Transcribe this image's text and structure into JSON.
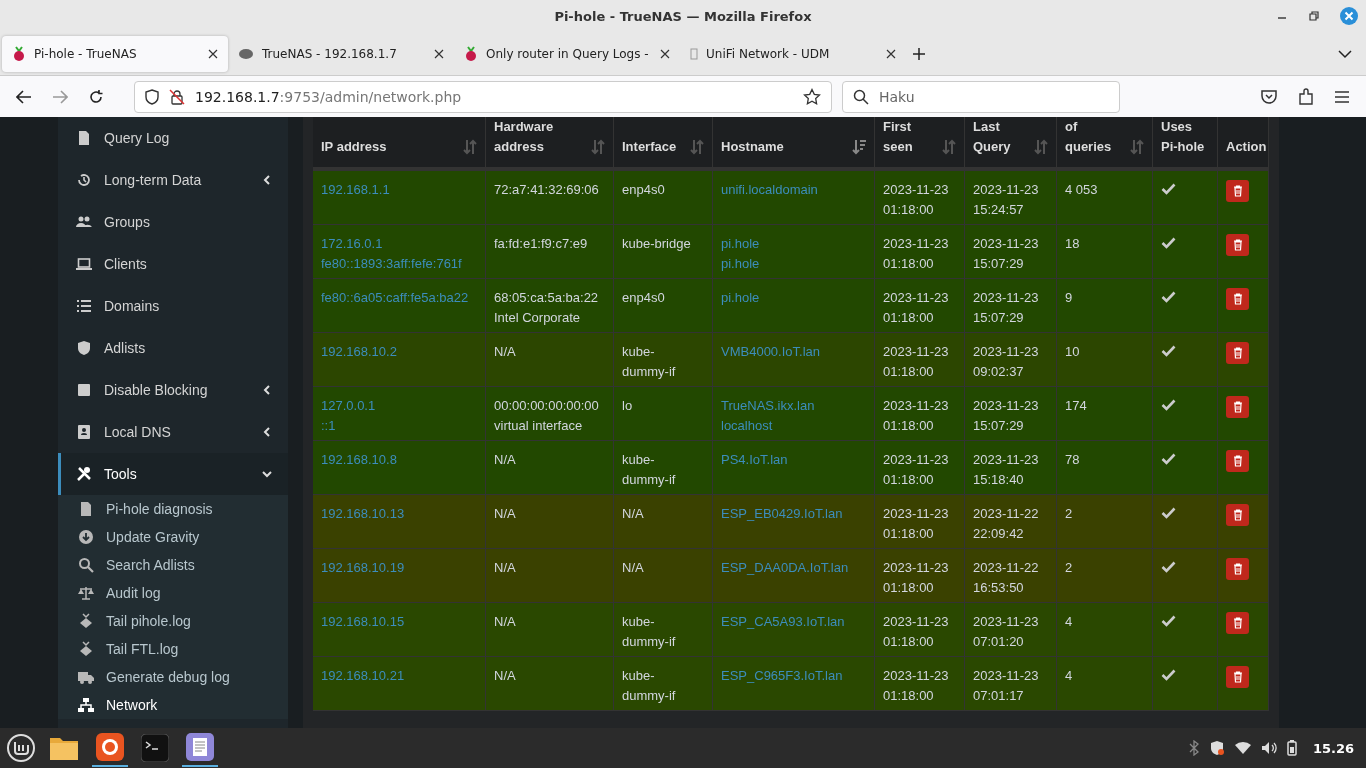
{
  "window": {
    "title": "Pi-hole - TrueNAS — Mozilla Firefox"
  },
  "tabs": [
    {
      "label": "Pi-hole - TrueNAS",
      "selected": true
    },
    {
      "label": "TrueNAS - 192.168.1.7",
      "selected": false
    },
    {
      "label": "Only router in Query Logs -",
      "selected": false
    },
    {
      "label": "UniFi Network - UDM",
      "selected": false
    }
  ],
  "address_bar": {
    "host": "192.168.1.7",
    "rest": ":9753/admin/network.php"
  },
  "search": {
    "placeholder": "Haku"
  },
  "sidebar": {
    "items": [
      {
        "label": "Query Log",
        "has_submenu": false,
        "expanded": false
      },
      {
        "label": "Long-term Data",
        "has_submenu": true,
        "expanded": false
      },
      {
        "label": "Groups",
        "has_submenu": false,
        "expanded": false
      },
      {
        "label": "Clients",
        "has_submenu": false,
        "expanded": false
      },
      {
        "label": "Domains",
        "has_submenu": false,
        "expanded": false
      },
      {
        "label": "Adlists",
        "has_submenu": false,
        "expanded": false
      },
      {
        "label": "Disable Blocking",
        "has_submenu": true,
        "expanded": false
      },
      {
        "label": "Local DNS",
        "has_submenu": true,
        "expanded": false
      },
      {
        "label": "Tools",
        "has_submenu": true,
        "expanded": true,
        "children": [
          {
            "label": "Pi-hole diagnosis",
            "selected": false
          },
          {
            "label": "Update Gravity",
            "selected": false
          },
          {
            "label": "Search Adlists",
            "selected": false
          },
          {
            "label": "Audit log",
            "selected": false
          },
          {
            "label": "Tail pihole.log",
            "selected": false
          },
          {
            "label": "Tail FTL.log",
            "selected": false
          },
          {
            "label": "Generate debug log",
            "selected": false
          },
          {
            "label": "Network",
            "selected": true
          }
        ]
      }
    ]
  },
  "table": {
    "columns": [
      {
        "lines": [
          "IP address"
        ],
        "sortable": true,
        "sorted": false
      },
      {
        "lines": [
          "Hardware",
          "address"
        ],
        "sortable": true,
        "sorted": false
      },
      {
        "lines": [
          "Interface"
        ],
        "sortable": true,
        "sorted": false
      },
      {
        "lines": [
          "Hostname"
        ],
        "sortable": true,
        "sorted": true
      },
      {
        "lines": [
          "First",
          "seen"
        ],
        "sortable": true,
        "sorted": false
      },
      {
        "lines": [
          "Last",
          "Query"
        ],
        "sortable": true,
        "sorted": false
      },
      {
        "lines": [
          "of",
          "queries"
        ],
        "sortable": true,
        "sorted": false
      },
      {
        "lines": [
          "Uses",
          "Pi-hole"
        ],
        "sortable": false
      },
      {
        "lines": [
          "Action"
        ],
        "sortable": false
      }
    ],
    "rows": [
      {
        "color": "#224800",
        "ips": [
          "192.168.1.1"
        ],
        "hardware": [
          "72:a7:41:32:69:06"
        ],
        "interface": [
          "enp4s0"
        ],
        "hostnames": [
          "unifi.localdomain"
        ],
        "first_seen": [
          "2023-11-23",
          "01:18:00"
        ],
        "last_query": [
          "2023-11-23",
          "15:24:57"
        ],
        "queries": "4 053",
        "uses_pihole": true
      },
      {
        "color": "#224800",
        "ips": [
          "172.16.0.1",
          "fe80::1893:3aff:fefe:761f"
        ],
        "hardware": [
          "fa:fd:e1:f9:c7:e9"
        ],
        "interface": [
          "kube-bridge"
        ],
        "hostnames": [
          "pi.hole",
          "pi.hole"
        ],
        "first_seen": [
          "2023-11-23",
          "01:18:00"
        ],
        "last_query": [
          "2023-11-23",
          "15:07:29"
        ],
        "queries": "18",
        "uses_pihole": true
      },
      {
        "color": "#224800",
        "ips": [
          "fe80::6a05:caff:fe5a:ba22"
        ],
        "hardware": [
          "68:05:ca:5a:ba:22",
          "Intel Corporate"
        ],
        "interface": [
          "enp4s0"
        ],
        "hostnames": [
          "pi.hole"
        ],
        "first_seen": [
          "2023-11-23",
          "01:18:00"
        ],
        "last_query": [
          "2023-11-23",
          "15:07:29"
        ],
        "queries": "9",
        "uses_pihole": true
      },
      {
        "color": "#2c4600",
        "ips": [
          "192.168.10.2"
        ],
        "hardware": [
          "N/A"
        ],
        "interface": [
          "kube-",
          "dummy-if"
        ],
        "hostnames": [
          "VMB4000.IoT.lan"
        ],
        "first_seen": [
          "2023-11-23",
          "01:18:00"
        ],
        "last_query": [
          "2023-11-23",
          "09:02:37"
        ],
        "queries": "10",
        "uses_pihole": true
      },
      {
        "color": "#224800",
        "ips": [
          "127.0.0.1",
          "::1"
        ],
        "hardware": [
          "00:00:00:00:00:00",
          "virtual interface"
        ],
        "interface": [
          "lo"
        ],
        "hostnames": [
          "TrueNAS.ikx.lan",
          "localhost"
        ],
        "first_seen": [
          "2023-11-23",
          "01:18:00"
        ],
        "last_query": [
          "2023-11-23",
          "15:07:29"
        ],
        "queries": "174",
        "uses_pihole": true
      },
      {
        "color": "#224800",
        "ips": [
          "192.168.10.8"
        ],
        "hardware": [
          "N/A"
        ],
        "interface": [
          "kube-",
          "dummy-if"
        ],
        "hostnames": [
          "PS4.IoT.lan"
        ],
        "first_seen": [
          "2023-11-23",
          "01:18:00"
        ],
        "last_query": [
          "2023-11-23",
          "15:18:40"
        ],
        "queries": "78",
        "uses_pihole": true
      },
      {
        "color": "#3a4100",
        "ips": [
          "192.168.10.13"
        ],
        "hardware": [
          "N/A"
        ],
        "interface": [
          "N/A"
        ],
        "hostnames": [
          "ESP_EB0429.IoT.lan"
        ],
        "first_seen": [
          "2023-11-23",
          "01:18:00"
        ],
        "last_query": [
          "2023-11-22",
          "22:09:42"
        ],
        "queries": "2",
        "uses_pihole": true
      },
      {
        "color": "#3a4100",
        "ips": [
          "192.168.10.19"
        ],
        "hardware": [
          "N/A"
        ],
        "interface": [
          "N/A"
        ],
        "hostnames": [
          "ESP_DAA0DA.IoT.lan"
        ],
        "first_seen": [
          "2023-11-23",
          "01:18:00"
        ],
        "last_query": [
          "2023-11-22",
          "16:53:50"
        ],
        "queries": "2",
        "uses_pihole": true
      },
      {
        "color": "#2a4800",
        "ips": [
          "192.168.10.15"
        ],
        "hardware": [
          "N/A"
        ],
        "interface": [
          "kube-",
          "dummy-if"
        ],
        "hostnames": [
          "ESP_CA5A93.IoT.lan"
        ],
        "first_seen": [
          "2023-11-23",
          "01:18:00"
        ],
        "last_query": [
          "2023-11-23",
          "07:01:20"
        ],
        "queries": "4",
        "uses_pihole": true
      },
      {
        "color": "#2a4800",
        "ips": [
          "192.168.10.21"
        ],
        "hardware": [
          "N/A"
        ],
        "interface": [
          "kube-",
          "dummy-if"
        ],
        "hostnames": [
          "ESP_C965F3.IoT.lan"
        ],
        "first_seen": [
          "2023-11-23",
          "01:18:00"
        ],
        "last_query": [
          "2023-11-23",
          "07:01:17"
        ],
        "queries": "4",
        "uses_pihole": true
      }
    ]
  },
  "taskbar": {
    "clock": "15.26"
  }
}
